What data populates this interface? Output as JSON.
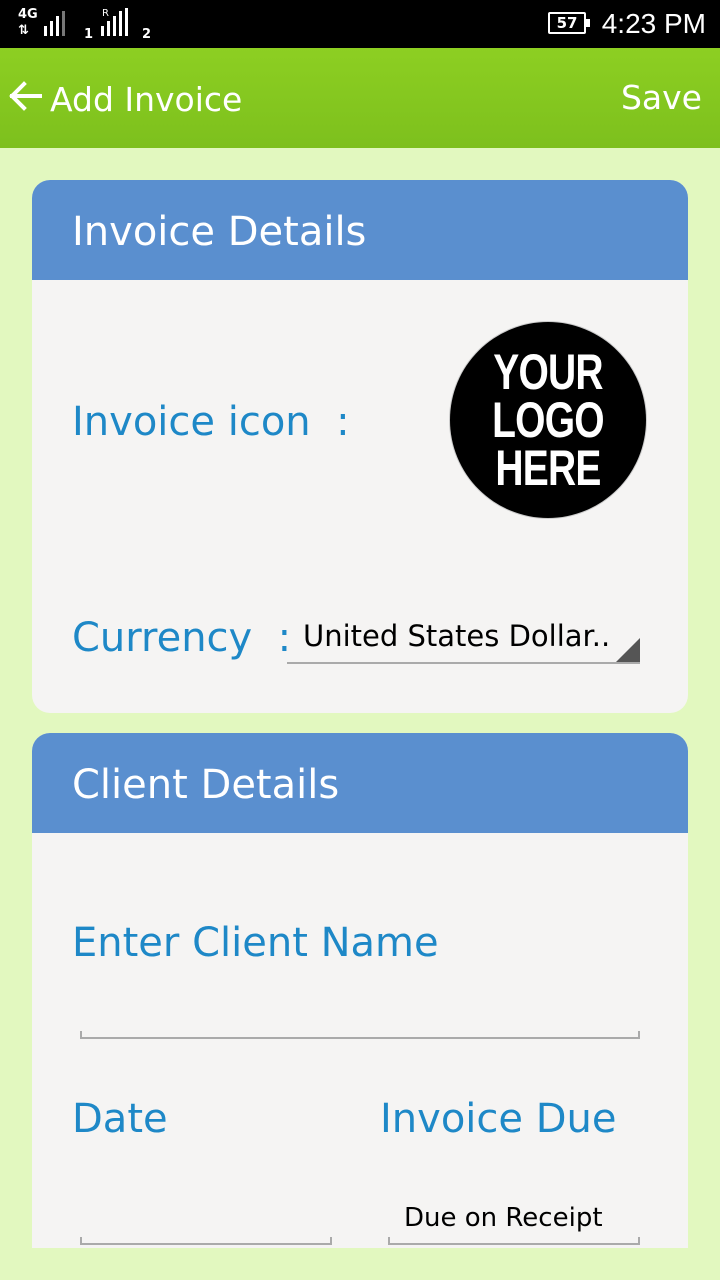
{
  "status_bar": {
    "network_type": "4G",
    "roaming_indicator": "R",
    "sim1_label": "1",
    "sim2_label": "2",
    "battery_level": "57",
    "time": "4:23 PM"
  },
  "app_bar": {
    "title": "Add Invoice",
    "save_label": "Save",
    "back_icon": "arrow-left-icon",
    "background_color": "#7dc01d"
  },
  "invoice_details": {
    "header": "Invoice Details",
    "icon_label": "Invoice icon  :",
    "logo_text": "YOUR LOGO HERE",
    "currency_label": "Currency  :",
    "currency_value": "United States Dollar..",
    "header_color": "#5a8fcf"
  },
  "client_details": {
    "header": "Client Details",
    "client_name_label": "Enter Client Name",
    "client_name_value": "",
    "date_label": "Date",
    "date_value": "",
    "invoice_due_label": "Invoice Due",
    "invoice_due_value": "Due on Receipt"
  },
  "colors": {
    "page_background": "#e2f8bf",
    "label_blue": "#1e88c7",
    "card_background": "#f5f4f3"
  }
}
